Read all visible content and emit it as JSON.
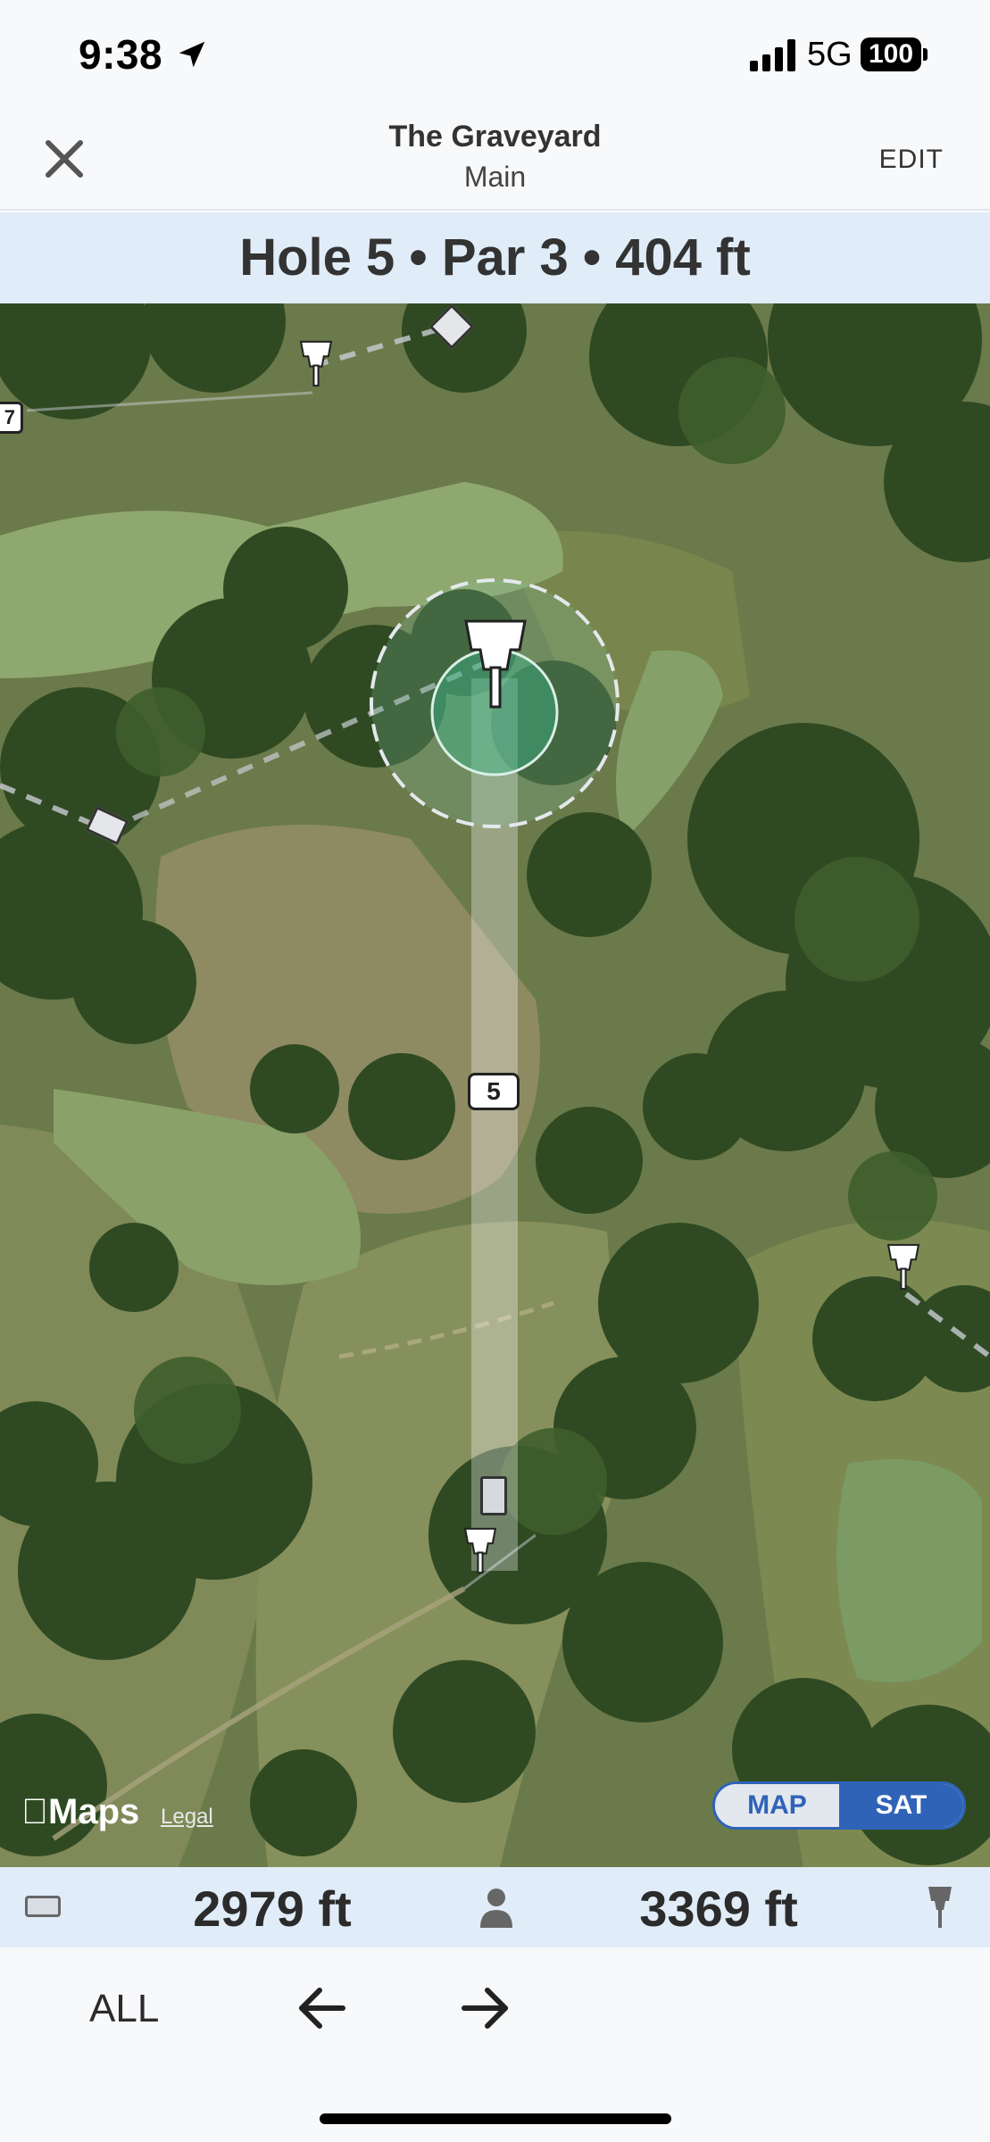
{
  "status_bar": {
    "time": "9:38",
    "network": "5G",
    "battery": "100"
  },
  "header": {
    "course_name": "The Graveyard",
    "layout_name": "Main",
    "edit_label": "EDIT",
    "close_icon": "close-icon"
  },
  "hole": {
    "label": "Hole 5  •  Par 3  •  404 ft"
  },
  "map": {
    "hole_marker": "5",
    "side_marker": "7",
    "maps_brand": "Maps",
    "legal_label": "Legal",
    "toggle": {
      "map_label": "MAP",
      "sat_label": "SAT",
      "selected": "SAT"
    }
  },
  "distances": {
    "from_tee": "2979 ft",
    "to_basket": "3369 ft"
  },
  "bottom_nav": {
    "all_label": "ALL"
  },
  "colors": {
    "accent": "#2f63b8",
    "header_band": "#e1ecf9",
    "background": "#f8f9fb"
  }
}
